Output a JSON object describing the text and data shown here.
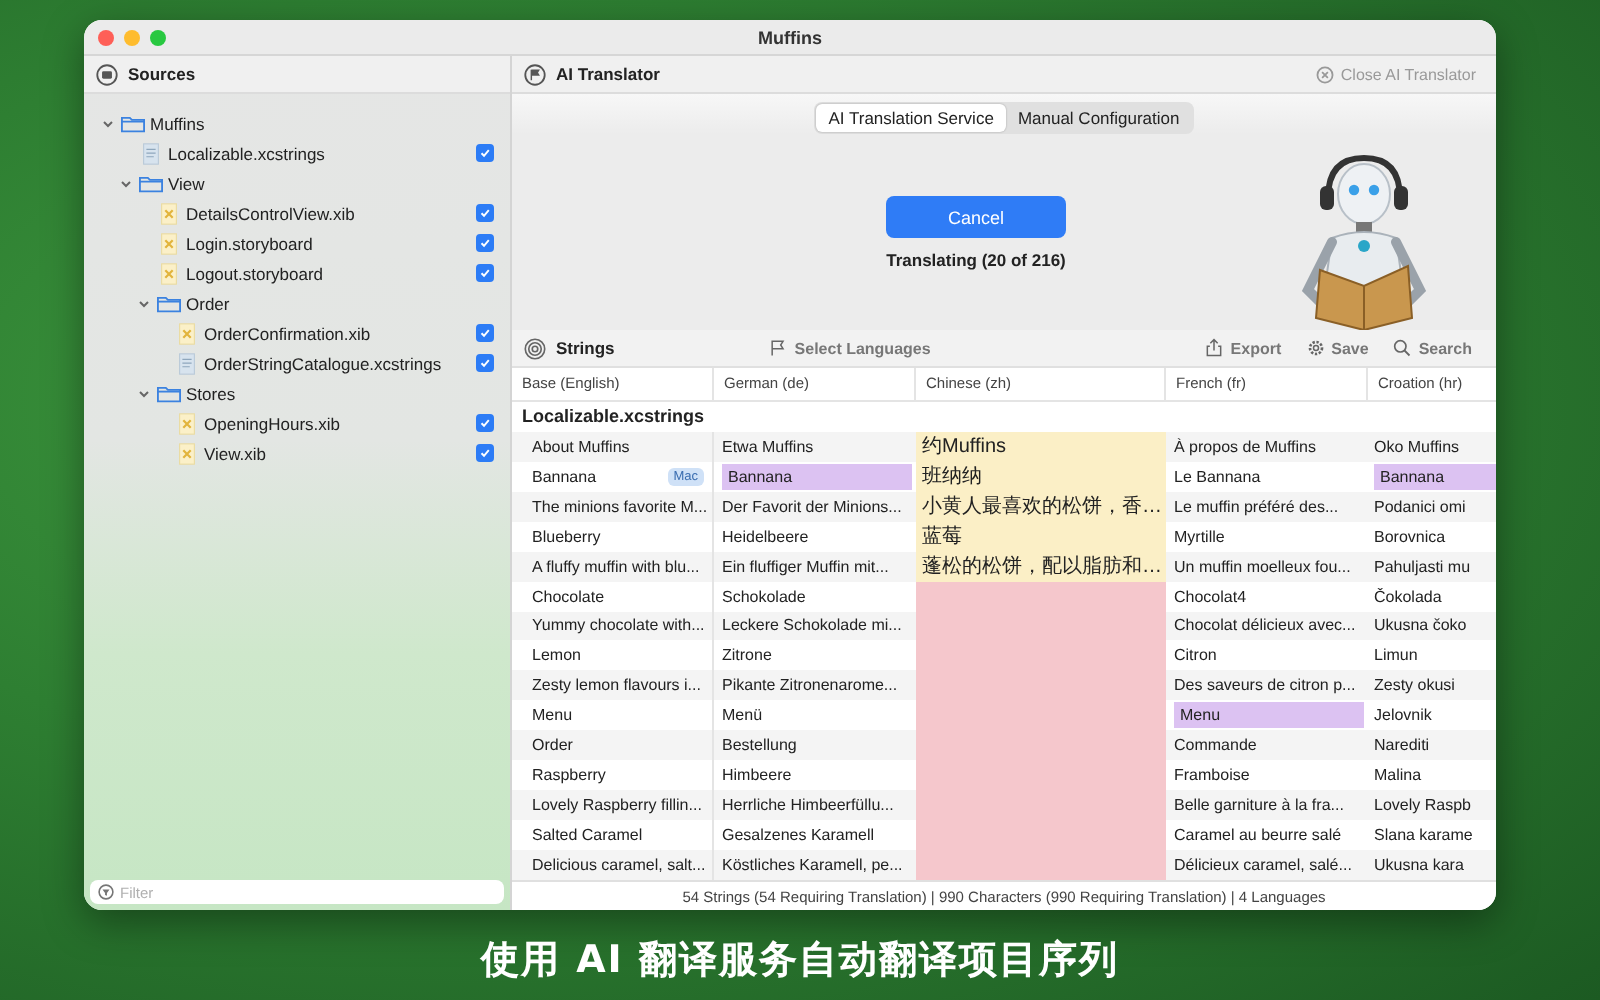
{
  "window": {
    "title": "Muffins"
  },
  "sidebar": {
    "title": "Sources",
    "tree": [
      {
        "kind": "folder",
        "label": "Muffins",
        "expanded": true,
        "children": [
          {
            "kind": "strings",
            "label": "Localizable.xcstrings",
            "checked": true
          },
          {
            "kind": "folder",
            "label": "View",
            "expanded": true,
            "children": [
              {
                "kind": "interface",
                "label": "DetailsControlView.xib",
                "checked": true
              },
              {
                "kind": "interface",
                "label": "Login.storyboard",
                "checked": true
              },
              {
                "kind": "interface",
                "label": "Logout.storyboard",
                "checked": true
              },
              {
                "kind": "folder",
                "label": "Order",
                "expanded": true,
                "children": [
                  {
                    "kind": "interface",
                    "label": "OrderConfirmation.xib",
                    "checked": true
                  },
                  {
                    "kind": "strings",
                    "label": "OrderStringCatalogue.xcstrings",
                    "checked": true
                  }
                ]
              },
              {
                "kind": "folder",
                "label": "Stores",
                "expanded": true,
                "children": [
                  {
                    "kind": "interface",
                    "label": "OpeningHours.xib",
                    "checked": true
                  },
                  {
                    "kind": "interface",
                    "label": "View.xib",
                    "checked": true
                  }
                ]
              }
            ]
          }
        ]
      }
    ],
    "filter": {
      "placeholder": "Filter"
    }
  },
  "translator": {
    "title": "AI Translator",
    "close": "Close AI Translator",
    "tabs": [
      {
        "label": "AI Translation Service",
        "selected": true
      },
      {
        "label": "Manual Configuration",
        "selected": false
      }
    ],
    "button": "Cancel",
    "progress": "Translating (20 of 216)"
  },
  "strings": {
    "title": "Strings",
    "toolbar": [
      {
        "kind": "flag",
        "label": "Select Languages"
      },
      {
        "kind": "export",
        "label": "Export"
      },
      {
        "kind": "save",
        "label": "Save"
      },
      {
        "kind": "search",
        "label": "Search"
      }
    ],
    "columns": [
      "Base (English)",
      "German (de)",
      "Chinese (zh)",
      "French (fr)",
      "Croation (hr)"
    ],
    "group": "Localizable.xcstrings",
    "rows": [
      {
        "cells": [
          {
            "text": "About Muffins"
          },
          {
            "text": "Etwa Muffins"
          },
          {
            "text": "约Muffins",
            "color": "#fbefc6"
          },
          {
            "text": "À propos de Muffins"
          },
          {
            "text": "Oko Muffins"
          }
        ]
      },
      {
        "cells": [
          {
            "text": "Bannana",
            "badge": "Mac"
          },
          {
            "text": "Bannana",
            "color": "#dcc2f2"
          },
          {
            "text": "班纳纳",
            "color": "#fbefc6"
          },
          {
            "text": "Le Bannana"
          },
          {
            "text": "Bannana",
            "color": "#dcc2f2"
          }
        ]
      },
      {
        "cells": [
          {
            "text": "The minions favorite M..."
          },
          {
            "text": "Der Favorit der Minions..."
          },
          {
            "text": "小黄人最喜欢的松饼，香…",
            "color": "#fbefc6"
          },
          {
            "text": "Le muffin préféré des..."
          },
          {
            "text": "Podanici omi"
          }
        ]
      },
      {
        "cells": [
          {
            "text": "Blueberry"
          },
          {
            "text": "Heidelbeere"
          },
          {
            "text": "蓝莓",
            "color": "#fbefc6"
          },
          {
            "text": "Myrtille"
          },
          {
            "text": "Borovnica"
          }
        ]
      },
      {
        "cells": [
          {
            "text": "A fluffy muffin with blu..."
          },
          {
            "text": "Ein fluffiger Muffin mit..."
          },
          {
            "text": "蓬松的松饼，配以脂肪和…",
            "color": "#fbefc6"
          },
          {
            "text": "Un muffin moelleux fou..."
          },
          {
            "text": "Pahuljasti mu"
          }
        ]
      },
      {
        "cells": [
          {
            "text": "Chocolate"
          },
          {
            "text": "Schokolade"
          },
          {
            "color": "#f5c7cc"
          },
          {
            "text": "Chocolat4"
          },
          {
            "text": "Čokolada"
          }
        ]
      },
      {
        "cells": [
          {
            "text": "Yummy chocolate with..."
          },
          {
            "text": "Leckere Schokolade mi..."
          },
          {
            "color": "#f5c7cc"
          },
          {
            "text": "Chocolat délicieux avec..."
          },
          {
            "text": "Ukusna čoko"
          }
        ]
      },
      {
        "cells": [
          {
            "text": "Lemon"
          },
          {
            "text": "Zitrone"
          },
          {
            "color": "#f5c7cc"
          },
          {
            "text": "Citron"
          },
          {
            "text": "Limun"
          }
        ]
      },
      {
        "cells": [
          {
            "text": "Zesty lemon flavours i..."
          },
          {
            "text": "Pikante Zitronenarome..."
          },
          {
            "color": "#f5c7cc"
          },
          {
            "text": "Des saveurs de citron p..."
          },
          {
            "text": "Zesty okusi"
          }
        ]
      },
      {
        "cells": [
          {
            "text": "Menu"
          },
          {
            "text": "Menü"
          },
          {
            "color": "#f5c7cc"
          },
          {
            "text": "Menu",
            "color": "#dcc2f2"
          },
          {
            "text": "Jelovnik"
          }
        ]
      },
      {
        "cells": [
          {
            "text": "Order"
          },
          {
            "text": "Bestellung"
          },
          {
            "color": "#f5c7cc"
          },
          {
            "text": "Commande"
          },
          {
            "text": "Narediti"
          }
        ]
      },
      {
        "cells": [
          {
            "text": "Raspberry"
          },
          {
            "text": "Himbeere"
          },
          {
            "color": "#f5c7cc"
          },
          {
            "text": "Framboise"
          },
          {
            "text": "Malina"
          }
        ]
      },
      {
        "cells": [
          {
            "text": "Lovely Raspberry fillin..."
          },
          {
            "text": "Herrliche Himbeerfüllu..."
          },
          {
            "color": "#f5c7cc"
          },
          {
            "text": "Belle garniture à la fra..."
          },
          {
            "text": "Lovely Raspb"
          }
        ]
      },
      {
        "cells": [
          {
            "text": "Salted Caramel"
          },
          {
            "text": "Gesalzenes Karamell"
          },
          {
            "color": "#f5c7cc"
          },
          {
            "text": "Caramel au beurre salé"
          },
          {
            "text": "Slana karame"
          }
        ]
      },
      {
        "cells": [
          {
            "text": "Delicious caramel, salt..."
          },
          {
            "text": "Köstliches Karamell, pe..."
          },
          {
            "color": "#f5c7cc"
          },
          {
            "text": "Délicieux caramel, salé..."
          },
          {
            "text": "Ukusna kara"
          }
        ]
      }
    ],
    "status_bar": "54 Strings (54 Requiring Translation) | 990 Characters (990 Requiring Translation) | 4 Languages"
  },
  "caption": "使用 AI 翻译服务自动翻译项目序列"
}
